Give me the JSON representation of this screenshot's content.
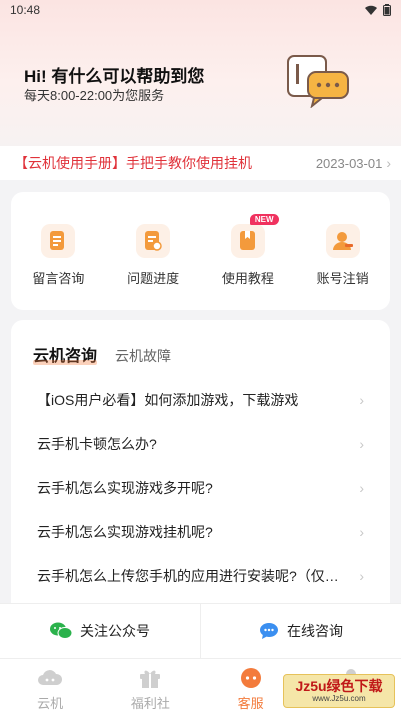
{
  "status_bar": {
    "time": "10:48"
  },
  "hero": {
    "title": "Hi! 有什么可以帮助到您",
    "subtitle": "每天8:00-22:00为您服务"
  },
  "notice": {
    "text": "【云机使用手册】手把手教你使用挂机",
    "date": "2023-03-01"
  },
  "actions": [
    {
      "label": "留言咨询",
      "icon": "message-doc-icon"
    },
    {
      "label": "问题进度",
      "icon": "progress-doc-icon"
    },
    {
      "label": "使用教程",
      "icon": "book-icon",
      "badge": "NEW"
    },
    {
      "label": "账号注销",
      "icon": "user-cancel-icon"
    }
  ],
  "faq": {
    "tabs": [
      "云机咨询",
      "云机故障"
    ],
    "active_tab": 0,
    "items": [
      "【iOS用户必看】如何添加游戏，下载游戏",
      "云手机卡顿怎么办?",
      "云手机怎么实现游戏多开呢?",
      "云手机怎么实现游戏挂机呢?",
      "云手机怎么上传您手机的应用进行安装呢?（仅适用于安卓）"
    ]
  },
  "bottom_actions": {
    "follow": "关注公众号",
    "online": "在线咨询"
  },
  "tabbar": [
    {
      "label": "云机",
      "icon": "cloud-icon"
    },
    {
      "label": "福利社",
      "icon": "gift-icon"
    },
    {
      "label": "客服",
      "icon": "service-icon"
    },
    {
      "label": "",
      "icon": "user-icon"
    }
  ],
  "active_tab": 2,
  "watermark": {
    "line1": "Jz5u绿色下载",
    "line2": "www.Jz5u.com"
  },
  "colors": {
    "accent": "#f37b3c",
    "notice_red": "#e0323a",
    "badge": "#f0325f"
  }
}
